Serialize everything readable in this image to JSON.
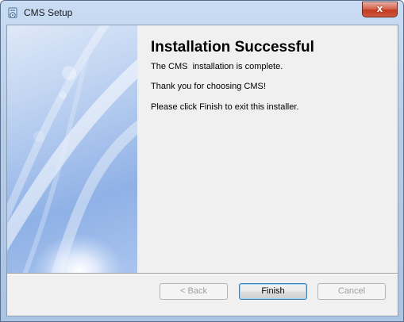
{
  "window": {
    "title": "CMS Setup",
    "close_label": "x"
  },
  "content": {
    "heading": "Installation Successful",
    "line1": "The CMS  installation is complete.",
    "line2": "Thank you for choosing CMS!",
    "line3": "Please click Finish to exit this installer."
  },
  "buttons": {
    "back": "< Back",
    "finish": "Finish",
    "cancel": "Cancel"
  },
  "icons": {
    "app": "setup-icon",
    "close": "close-icon"
  }
}
